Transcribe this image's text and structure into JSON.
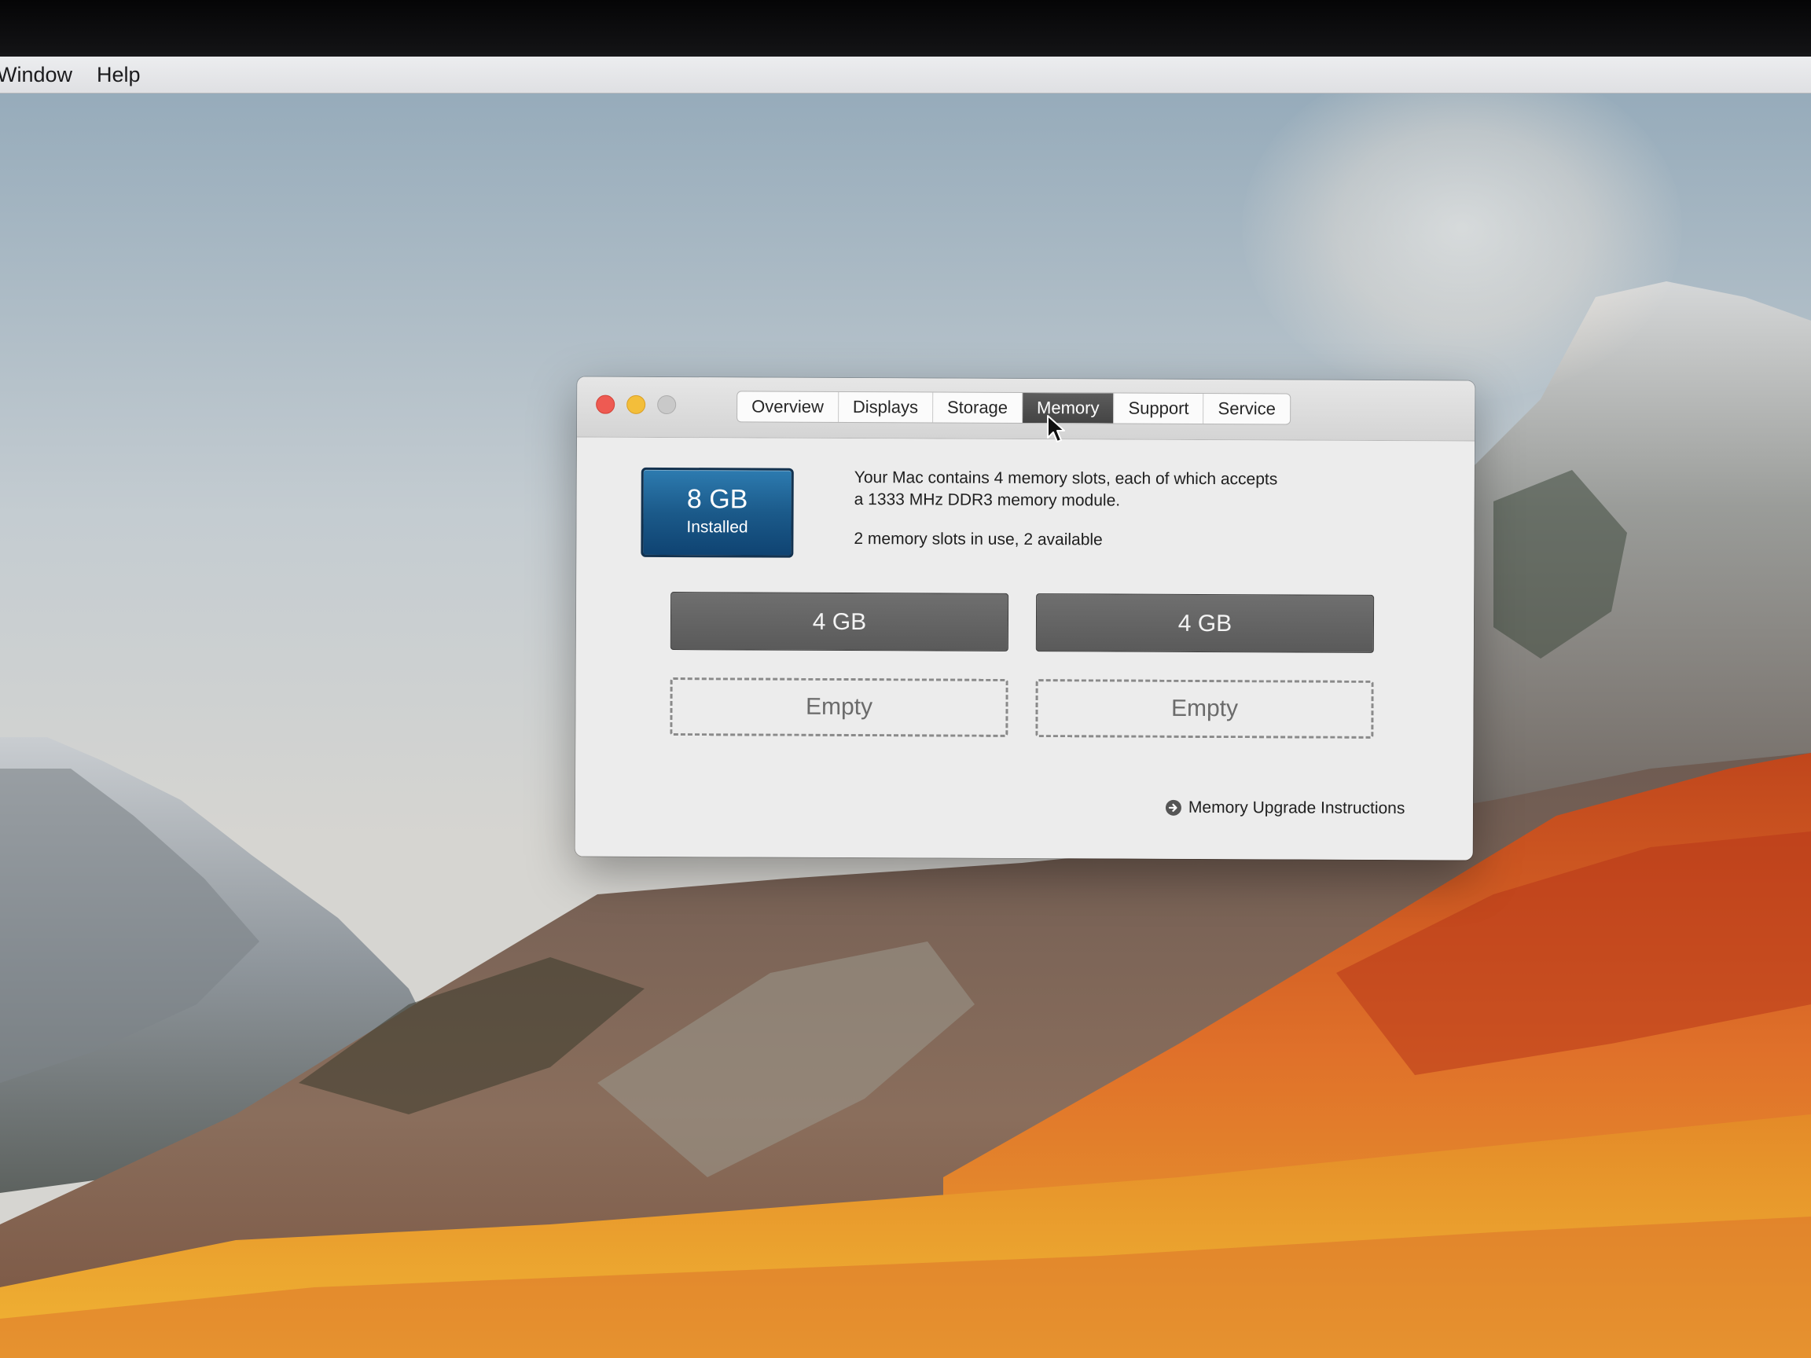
{
  "menubar": {
    "items": [
      "Window",
      "Help"
    ]
  },
  "window": {
    "tabs": [
      {
        "label": "Overview",
        "selected": false
      },
      {
        "label": "Displays",
        "selected": false
      },
      {
        "label": "Storage",
        "selected": false
      },
      {
        "label": "Memory",
        "selected": true
      },
      {
        "label": "Support",
        "selected": false
      },
      {
        "label": "Service",
        "selected": false
      }
    ],
    "memory": {
      "installed_amount": "8 GB",
      "installed_label": "Installed",
      "description_line1": "Your Mac contains 4 memory slots, each of which accepts",
      "description_line2": "a 1333 MHz DDR3 memory module.",
      "slots_status": "2 memory slots in use, 2 available",
      "slots": [
        {
          "label": "4 GB",
          "state": "filled"
        },
        {
          "label": "4 GB",
          "state": "filled"
        },
        {
          "label": "Empty",
          "state": "empty"
        },
        {
          "label": "Empty",
          "state": "empty"
        }
      ],
      "upgrade_link": "Memory Upgrade Instructions"
    }
  },
  "colors": {
    "close": "#ee5a52",
    "minimize": "#f3be3a",
    "zoom": "#c9c9c9",
    "badge": "#1b5a8a",
    "selected_tab": "#4a4a4a"
  },
  "icons": {
    "upgrade_link_icon": "right-arrow-circle-icon",
    "cursor": "mouse-pointer-icon"
  }
}
